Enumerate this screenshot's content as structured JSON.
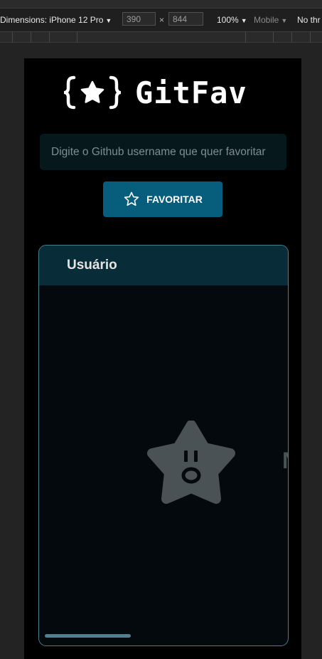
{
  "devtools": {
    "dimensions_label": "Dimensions: iPhone 12 Pro",
    "width": "390",
    "height": "844",
    "times": "×",
    "zoom": "100%",
    "mode": "Mobile",
    "throttle": "No thr"
  },
  "app": {
    "logo_text": "GitFav",
    "search": {
      "placeholder": "Digite o Github username que quer favoritar",
      "value": ""
    },
    "favorite_button_label": "FAVORITAR",
    "table": {
      "columns": [
        "Usuário"
      ],
      "rows": [],
      "empty_state_partial_text": "N"
    }
  },
  "colors": {
    "background": "#000000",
    "input_bg": "#06181c",
    "button_bg": "#065e7c",
    "table_header_bg": "#092d38",
    "table_border": "#4a7f8f",
    "empty_star": "#4a5256"
  }
}
